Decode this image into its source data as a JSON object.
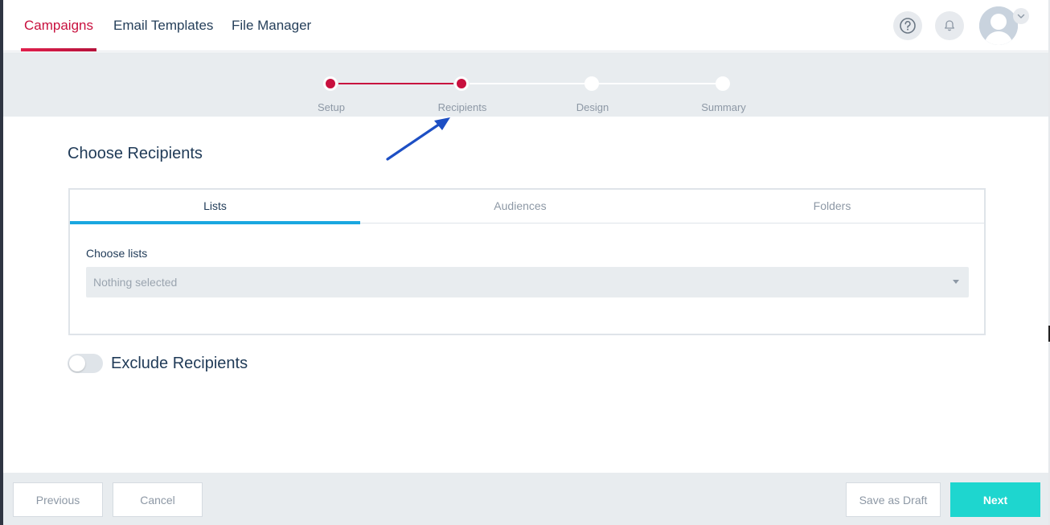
{
  "nav": {
    "tabs": [
      {
        "label": "Campaigns",
        "active": true
      },
      {
        "label": "Email Templates",
        "active": false
      },
      {
        "label": "File Manager",
        "active": false
      }
    ],
    "icons": [
      "help-icon",
      "bell-icon",
      "avatar",
      "chevron-down-icon"
    ]
  },
  "stepper": {
    "steps": [
      {
        "label": "Setup",
        "state": "done"
      },
      {
        "label": "Recipients",
        "state": "current"
      },
      {
        "label": "Design",
        "state": "todo"
      },
      {
        "label": "Summary",
        "state": "todo"
      }
    ]
  },
  "content": {
    "title": "Choose Recipients",
    "tabs": [
      {
        "label": "Lists",
        "active": true
      },
      {
        "label": "Audiences",
        "active": false
      },
      {
        "label": "Folders",
        "active": false
      }
    ],
    "field_label": "Choose lists",
    "select_value": "Nothing selected",
    "toggle_label": "Exclude Recipients",
    "toggle_on": false
  },
  "footer": {
    "previous": "Previous",
    "cancel": "Cancel",
    "save_draft": "Save as Draft",
    "next": "Next"
  },
  "colors": {
    "accent": "#c8103e",
    "tab_underline": "#1aa7e0",
    "next_button": "#1ed6cf",
    "annotation_arrow": "#1d4fc4"
  }
}
